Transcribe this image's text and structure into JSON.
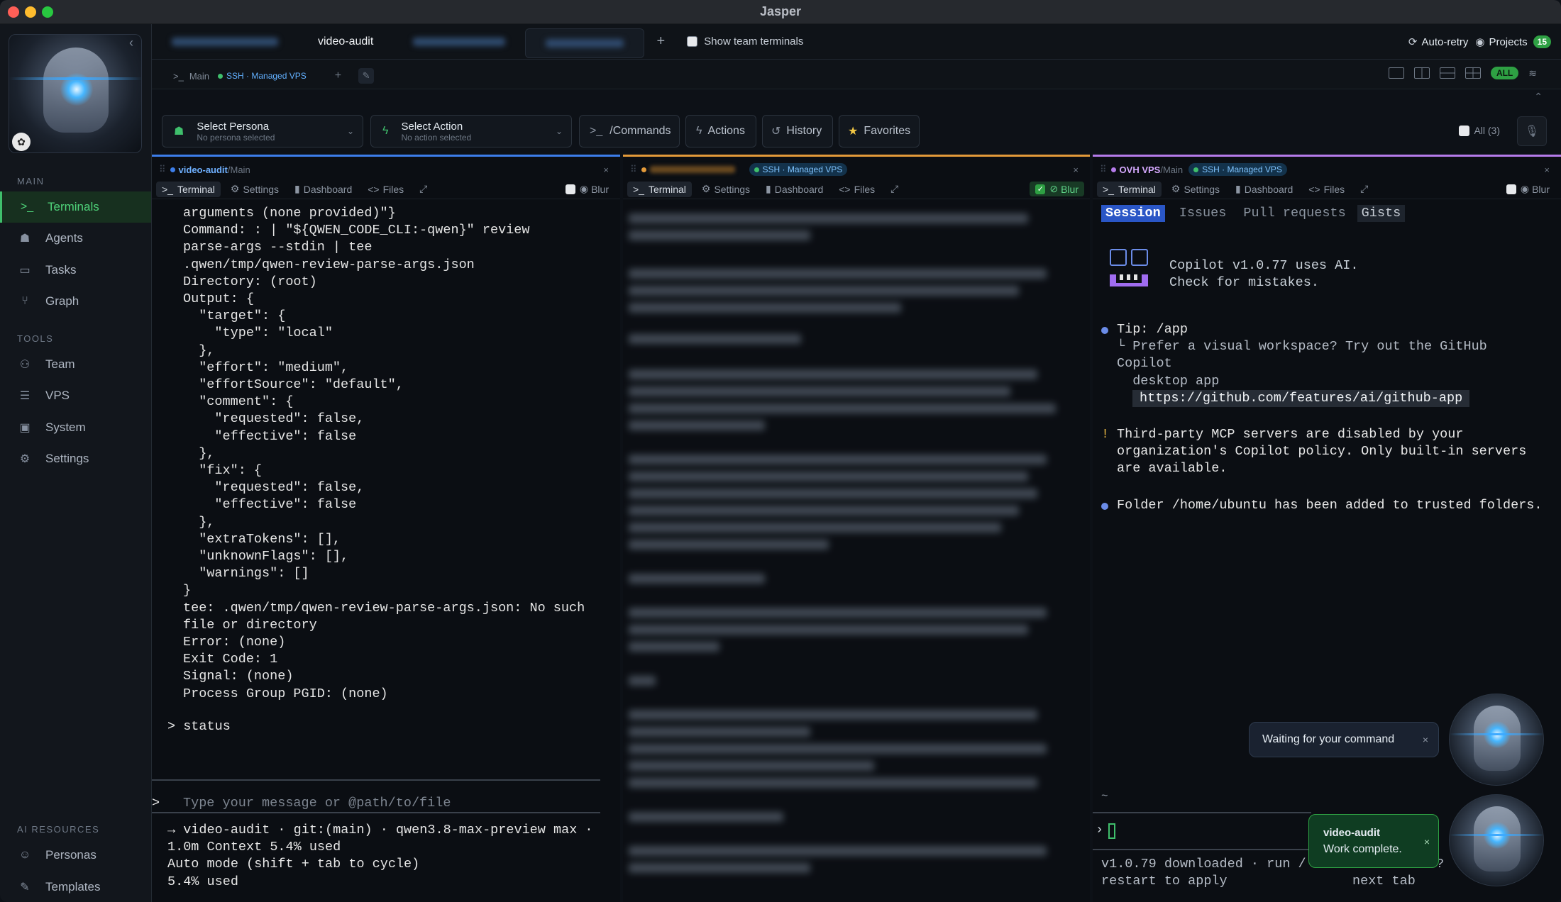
{
  "window": {
    "title": "Jasper"
  },
  "sidebar": {
    "sections": {
      "main": "MAIN",
      "tools": "TOOLS",
      "ai": "AI RESOURCES"
    },
    "main_items": [
      {
        "label": "Terminals",
        "icon": "terminal-icon",
        "active": true
      },
      {
        "label": "Agents",
        "icon": "robot-icon"
      },
      {
        "label": "Tasks",
        "icon": "clipboard-icon"
      },
      {
        "label": "Graph",
        "icon": "branch-icon"
      }
    ],
    "tool_items": [
      {
        "label": "Team",
        "icon": "users-icon"
      },
      {
        "label": "VPS",
        "icon": "server-icon"
      },
      {
        "label": "System",
        "icon": "cpu-icon"
      },
      {
        "label": "Settings",
        "icon": "gear-icon"
      }
    ],
    "ai_items": [
      {
        "label": "Personas",
        "icon": "persona-icon"
      },
      {
        "label": "Templates",
        "icon": "pen-icon"
      }
    ]
  },
  "topbar": {
    "tabs": [
      "video-audit"
    ],
    "add": "+",
    "show_team": "Show team terminals",
    "auto_retry": "Auto-retry",
    "projects": "Projects",
    "projects_count": "15"
  },
  "tabrow": {
    "main": "Main",
    "ssh": "SSH · Managed VPS",
    "add": "+",
    "all": "ALL"
  },
  "toolbar": {
    "persona": {
      "label": "Select Persona",
      "sub": "No persona selected"
    },
    "action": {
      "label": "Select Action",
      "sub": "No action selected"
    },
    "commands": "/Commands",
    "actions": "Actions",
    "history": "History",
    "favorites": "Favorites",
    "all": "All (3)"
  },
  "pane_tabs": {
    "terminal": "Terminal",
    "settings": "Settings",
    "dashboard": "Dashboard",
    "files": "Files",
    "blur": "Blur"
  },
  "pane1": {
    "project": "video-audit",
    "sep": " / ",
    "branch": "Main",
    "lines": [
      "arguments (none provided)\"}",
      "Command: : | \"${QWEN_CODE_CLI:-qwen}\" review",
      "parse-args --stdin | tee",
      ".qwen/tmp/qwen-review-parse-args.json",
      "Directory: (root)",
      "Output: {",
      "  \"target\": {",
      "    \"type\": \"local\"",
      "  },",
      "  \"effort\": \"medium\",",
      "  \"effortSource\": \"default\",",
      "  \"comment\": {",
      "    \"requested\": false,",
      "    \"effective\": false",
      "  },",
      "  \"fix\": {",
      "    \"requested\": false,",
      "    \"effective\": false",
      "  },",
      "  \"extraTokens\": [],",
      "  \"unknownFlags\": [],",
      "  \"warnings\": []",
      "}",
      "tee: .qwen/tmp/qwen-review-parse-args.json: No such",
      "file or directory",
      "Error: (none)",
      "Exit Code: 1",
      "Signal: (none)",
      "Process Group PGID: (none)"
    ],
    "prompt_line": "> status",
    "input_placeholder": "Type your message or @path/to/file",
    "footer": [
      "→ video-audit · git:(main) · qwen3.8-max-preview max ·",
      "1.0m Context 5.4% used",
      "Auto mode (shift + tab to cycle)",
      "5.4% used"
    ]
  },
  "pane2": {
    "ssh": "SSH · Managed VPS"
  },
  "pane3": {
    "host": "OVH VPS",
    "sep": " / ",
    "branch": "Main",
    "ssh": "SSH · Managed VPS",
    "gh_tabs": [
      "Session",
      "Issues",
      "Pull requests",
      "Gists"
    ],
    "copilot_line1": "Copilot v1.0.77 uses AI.",
    "copilot_line2": "Check for mistakes.",
    "tip_lines": [
      "Tip: /app",
      "└ Prefer a visual workspace? Try out the GitHub",
      "Copilot",
      "  desktop app"
    ],
    "tip_url": "https://github.com/features/ai/github-app",
    "warn_lines": [
      "Third-party MCP servers are disabled by your",
      "organization's Copilot policy. Only built-in servers",
      "are available."
    ],
    "folder_line": "Folder /home/ubuntu has been added to trusted folders.",
    "tilde": "~",
    "footer1": "v1.0.79 downloaded · run /",
    "footer2": "restart to apply",
    "next_tab": "next tab",
    "question": "?"
  },
  "toasts": {
    "waiting": "Waiting for your command",
    "done_title": "video-audit",
    "done_msg": "Work complete."
  },
  "colors": {
    "accent_green": "#3fbf6c",
    "accent_blue": "#3d7eea",
    "pane2_orange": "#e39a3a",
    "pane3_purple": "#b57bea"
  }
}
